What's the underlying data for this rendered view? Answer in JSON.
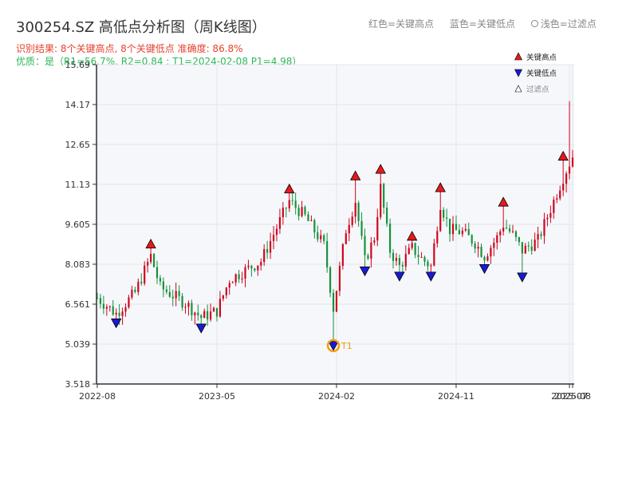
{
  "title": "300254.SZ 高低点分析图（周K线图）",
  "top_legend": {
    "red": "红色=关键高点",
    "blue": "蓝色=关键低点",
    "light": "浅色=过滤点"
  },
  "stats": {
    "line1": "识别结果: 8个关键高点, 8个关键低点  准确度: 86.8%",
    "line2": "优质：是（R1=56.7%, R2=0.84 ; T1=2024-02-08 P1=4.98）"
  },
  "colors": {
    "up": "#d0021b",
    "down": "#15913a",
    "high_marker": "#e8191c",
    "low_marker": "#1a1ad6",
    "t1_ring": "#f39c12",
    "plot_bg": "#f5f7fa"
  },
  "chart_data": {
    "type": "candlestick",
    "x_ticks": [
      "2022-08",
      "2023-05",
      "2024-02",
      "2024-11",
      "2025-07",
      "2025-08"
    ],
    "x_tick_pos": [
      0,
      38,
      76,
      114,
      150,
      151
    ],
    "y_ticks": [
      "3.518",
      "5.039",
      "6.561",
      "8.083",
      "9.605",
      "11.13",
      "12.65",
      "14.17",
      "15.69"
    ],
    "ylim": [
      3.518,
      15.69
    ],
    "legend": {
      "high": "关键高点",
      "low": "关键低点",
      "filtered": "过滤点"
    },
    "grid": true,
    "key_highs": [
      {
        "i": 17,
        "v": 8.85
      },
      {
        "i": 61,
        "v": 10.95
      },
      {
        "i": 82,
        "v": 11.45
      },
      {
        "i": 90,
        "v": 11.7
      },
      {
        "i": 100,
        "v": 9.15
      },
      {
        "i": 109,
        "v": 11.0
      },
      {
        "i": 129,
        "v": 10.45
      },
      {
        "i": 148,
        "v": 12.2
      }
    ],
    "key_lows": [
      {
        "i": 6,
        "v": 5.85
      },
      {
        "i": 33,
        "v": 5.65
      },
      {
        "i": 75,
        "v": 4.98
      },
      {
        "i": 85,
        "v": 7.83
      },
      {
        "i": 96,
        "v": 7.63
      },
      {
        "i": 106,
        "v": 7.63
      },
      {
        "i": 123,
        "v": 7.92
      },
      {
        "i": 135,
        "v": 7.6
      }
    ],
    "annotation": {
      "label": "T1",
      "i": 75,
      "v": 4.98
    }
  }
}
